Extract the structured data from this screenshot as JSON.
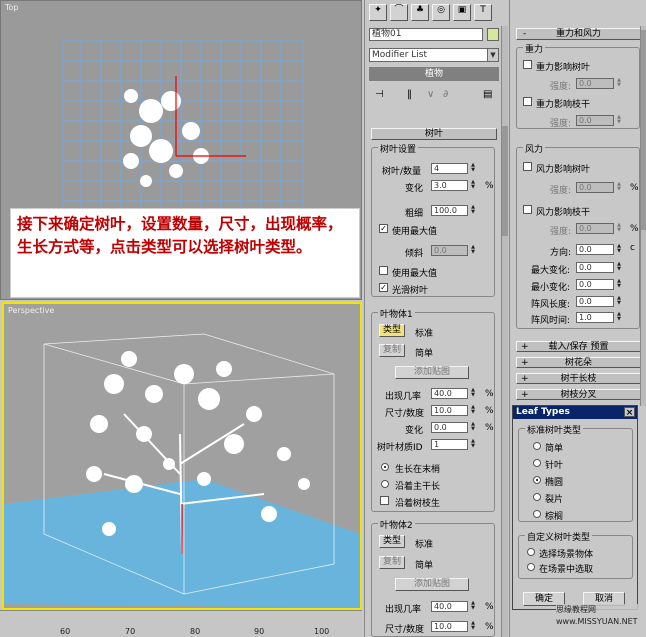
{
  "viewports": {
    "top_label": "Top",
    "persp_label": "Perspective"
  },
  "note": "接下来确定树叶，设置数量，尺寸，出现概率，生长方式等，点击类型可以选择树叶类型。",
  "ruler_ticks": [
    "60",
    "70",
    "80",
    "90",
    "100"
  ],
  "cmd_panel": {
    "tab_icons": [
      "create-icon",
      "modify-icon",
      "hierarchy-icon",
      "motion-icon",
      "display-icon",
      "utilities-icon"
    ],
    "object_name": "植物01",
    "modifier_list": "Modifier List",
    "stack_item": "植物"
  },
  "leaves": {
    "rollout_title": "树叶",
    "settings_title": "树叶设置",
    "count_label": "树叶/数量",
    "count_value": "4",
    "spread_label": "变化",
    "spread_value": "3.0",
    "spread_unit": "%",
    "thickness_label": "粗细",
    "thickness_value": "100.0",
    "use_max_label": "使用最大值",
    "angle_label": "倾斜",
    "angle_value": "0.0",
    "use_min_label": "使用最大值",
    "smooth_label": "光滑树叶",
    "leaf_obj1_title": "叶物体1",
    "type_button": "类型",
    "type_value": "标准",
    "copy_button": "复制",
    "copy_value": "简单",
    "add_button": "添加贴图",
    "prob_label": "出现几率",
    "prob_value": "40.0",
    "prob_unit": "%",
    "size_label": "尺寸/数度",
    "size_value": "10.0",
    "size_unit": "%",
    "var_label": "变化",
    "var_value": "0.0",
    "var_unit": "%",
    "mat_label": "树叶材质ID",
    "mat_value": "1",
    "grow_end": "生长在末梢",
    "grow_trunk": "沿着主干长",
    "grow_branch": "沿着树枝生",
    "leaf_obj2_title": "叶物体2",
    "type_button2": "类型",
    "type_value2": "标准",
    "copy_button2": "复制",
    "copy_value2": "简单",
    "add_button2": "添加贴图",
    "prob_label2": "出现几率",
    "prob_value2": "40.0",
    "prob_unit2": "%",
    "size_label2": "尺寸/数度",
    "size_value2": "10.0",
    "size_unit2": "%"
  },
  "gravity": {
    "rollout_title": "重力和风力",
    "gravity_title": "重力",
    "g_leaf_label": "重力影响树叶",
    "g_strength_label": "强度:",
    "g_strength_value": "0.0",
    "g_branch_label": "重力影响枝干",
    "g_strength2_label": "强度:",
    "g_strength2_value": "0.0",
    "wind_title": "风力",
    "w_leaf_label": "风力影响树叶",
    "w_strength_label": "强度:",
    "w_strength_value": "0.0",
    "w_strength_unit": "%",
    "w_branch_label": "风力影响枝干",
    "w_strength2_label": "强度:",
    "w_strength2_value": "0.0",
    "w_strength2_unit": "%",
    "dir_label": "方向:",
    "dir_value": "0.0",
    "dir_unit": "c",
    "max_change_label": "最大变化:",
    "max_change_value": "0.0",
    "min_change_label": "最小变化:",
    "min_change_value": "0.0",
    "gust_len_label": "阵风长度:",
    "gust_len_value": "0.0",
    "gust_time_label": "阵风时间:",
    "gust_time_value": "1.0"
  },
  "rollouts": [
    "载入/保存 预置",
    "树花朵",
    "树干长枝",
    "树枝分叉"
  ],
  "leaf_types": {
    "title": "Leaf Types",
    "close": "×",
    "std_title": "标准树叶类型",
    "options": [
      "简单",
      "针叶",
      "椭圆",
      "裂片",
      "棕榈"
    ],
    "selected_index": 2,
    "custom_title": "自定义树叶类型",
    "custom_options": [
      "选择场景物体",
      "在场景中选取"
    ],
    "ok": "确定",
    "cancel": "取消"
  },
  "watermark": "思缘教程网\nwww.MISSYUAN.NET"
}
